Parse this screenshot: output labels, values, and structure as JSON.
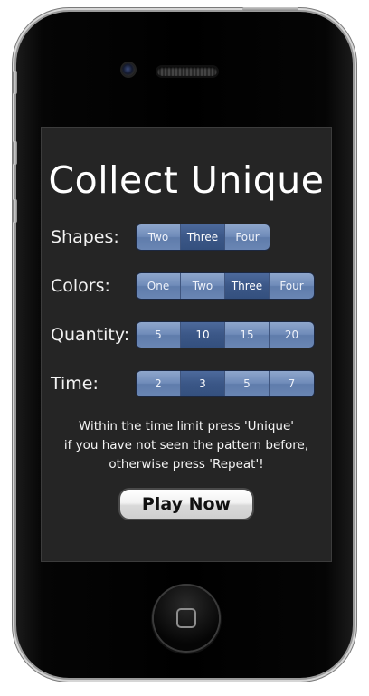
{
  "screen": {
    "title": "Collect Unique",
    "rows": [
      {
        "label": "Shapes:",
        "options": [
          "Two",
          "Three",
          "Four"
        ],
        "selected": "Three"
      },
      {
        "label": "Colors:",
        "options": [
          "One",
          "Two",
          "Three",
          "Four"
        ],
        "selected": "Three"
      },
      {
        "label": "Quantity:",
        "options": [
          "5",
          "10",
          "15",
          "20"
        ],
        "selected": "10"
      },
      {
        "label": "Time:",
        "options": [
          "2",
          "3",
          "5",
          "7"
        ],
        "selected": "3"
      }
    ],
    "instructions": [
      "Within the time limit press 'Unique'",
      "if you have not seen the pattern before,",
      "otherwise press 'Repeat'!"
    ],
    "play_button": "Play Now"
  },
  "colors": {
    "segment": "#6f8bb9",
    "segment_selected": "#3b5787",
    "screen_bg": "#252525"
  },
  "icons": [
    "home-square-icon"
  ]
}
